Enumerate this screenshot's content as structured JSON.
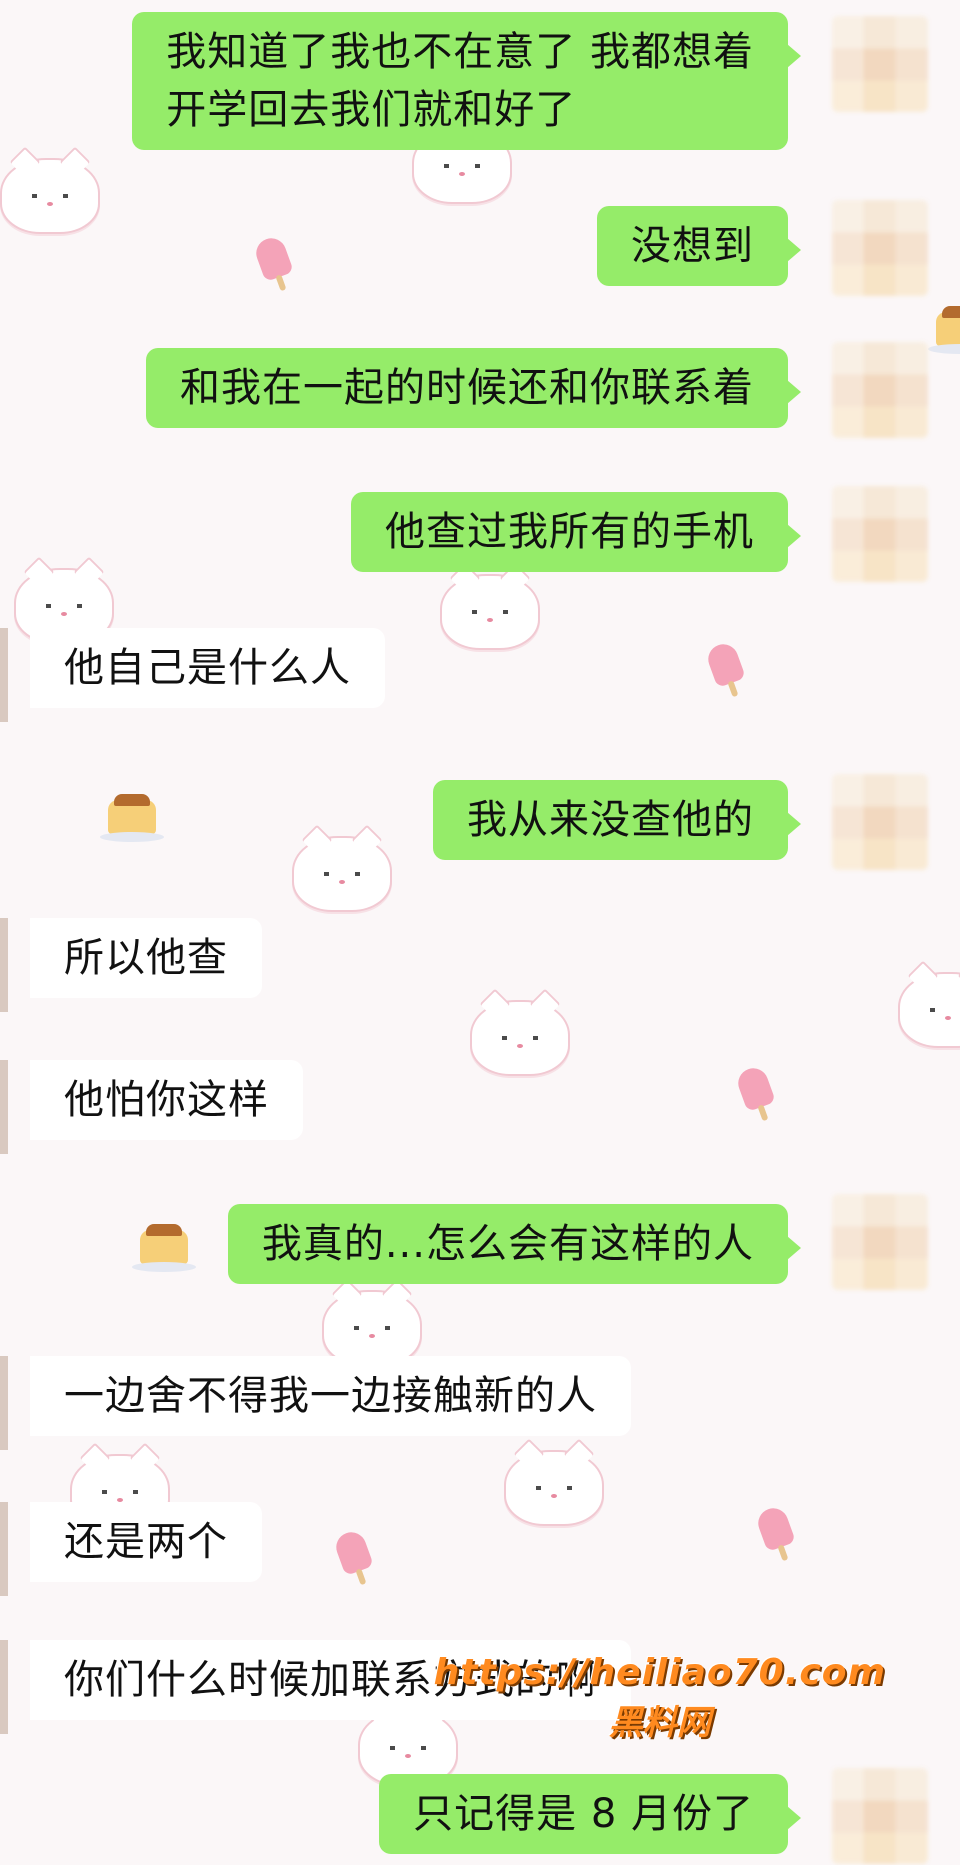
{
  "messages": [
    {
      "side": "sent",
      "text_lines": [
        "我知道了我也不在意了 我都想着",
        "开学回去我们就和好了"
      ]
    },
    {
      "side": "sent",
      "text_lines": [
        "没想到"
      ]
    },
    {
      "side": "sent",
      "text_lines": [
        "和我在一起的时候还和你联系着"
      ]
    },
    {
      "side": "sent",
      "text_lines": [
        "他查过我所有的手机"
      ]
    },
    {
      "side": "received",
      "text_lines": [
        "他自己是什么人"
      ]
    },
    {
      "side": "sent",
      "text_lines": [
        "我从来没查他的"
      ]
    },
    {
      "side": "received",
      "text_lines": [
        "所以他查"
      ]
    },
    {
      "side": "received",
      "text_lines": [
        "他怕你这样"
      ]
    },
    {
      "side": "sent",
      "text_lines": [
        "我真的...怎么会有这样的人"
      ]
    },
    {
      "side": "received",
      "text_lines": [
        "一边舍不得我一边接触新的人"
      ]
    },
    {
      "side": "received",
      "text_lines": [
        "还是两个"
      ]
    },
    {
      "side": "received",
      "text_lines": [
        "你们什么时候加联系方式的啊"
      ]
    },
    {
      "side": "sent",
      "text_lines": [
        "只记得是 8 月份了"
      ]
    }
  ],
  "watermark": {
    "url": "https://heiliao70.com",
    "name": "黑料网"
  },
  "colors": {
    "sent_bubble": "#95ec69",
    "received_bubble": "#ffffff",
    "background": "#fbf7f8",
    "watermark": "#ff8a1f"
  },
  "icons": {
    "avatar": "blurred-avatar",
    "wallpaper": [
      "cat-icon",
      "popsicle-icon",
      "pudding-icon"
    ]
  }
}
